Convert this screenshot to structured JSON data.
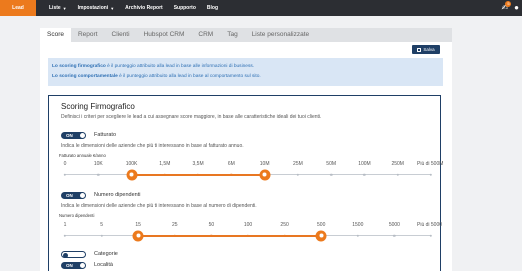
{
  "nav": {
    "brand": "Lead",
    "items": [
      {
        "label": "Liste",
        "caret": true
      },
      {
        "label": "Impostazioni",
        "caret": true
      },
      {
        "label": "Archivio Report",
        "caret": false
      },
      {
        "label": "Supporto",
        "caret": false
      },
      {
        "label": "Blog",
        "caret": false
      }
    ],
    "notif_count": "5"
  },
  "tabs": [
    "Score",
    "Report",
    "Clienti",
    "Hubspot CRM",
    "CRM",
    "Tag",
    "Liste personalizzate"
  ],
  "active_tab": 0,
  "save_label": "Salva",
  "info": {
    "line1_bold": "Lo scoring firmografico",
    "line1_rest": " è il punteggio attribuito alla lead in base alle informazioni di business.",
    "line2_bold": "Lo scoring comportamentale",
    "line2_rest": " è il punteggio attribuito alla lead in base al comportamento sul sito."
  },
  "card": {
    "title": "Scoring Firmografico",
    "subtitle": "Definisci i criteri per scegliere le lead a cui assegnare score maggiore, in base alle caratteristiche ideali dei tuoi clienti."
  },
  "sections": [
    {
      "toggle": "ON",
      "on": true,
      "label": "Fatturato",
      "desc": "Indica le dimensioni delle aziende che più ti interessano in base al fatturato annuo.",
      "title": "Fatturato annuale €/anno",
      "ticks": [
        "0",
        "10K",
        "100K",
        "1,5M",
        "3,5M",
        "6M",
        "10M",
        "25M",
        "50M",
        "100M",
        "250M",
        "Più di 500M"
      ],
      "range": [
        2,
        6
      ]
    },
    {
      "toggle": "ON",
      "on": true,
      "label": "Numero dipendenti",
      "desc": "Indica le dimensioni delle aziende che più ti interessano in base al numero di dipendenti.",
      "title": "Numero dipendenti",
      "ticks": [
        "1",
        "5",
        "15",
        "25",
        "50",
        "100",
        "250",
        "500",
        "1500",
        "5000",
        "Più di 5000"
      ],
      "range": [
        2,
        7
      ]
    }
  ],
  "extra_toggles": [
    {
      "label": "Categorie",
      "on": false
    },
    {
      "toggle": "ON",
      "label": "Località",
      "on": true
    }
  ]
}
